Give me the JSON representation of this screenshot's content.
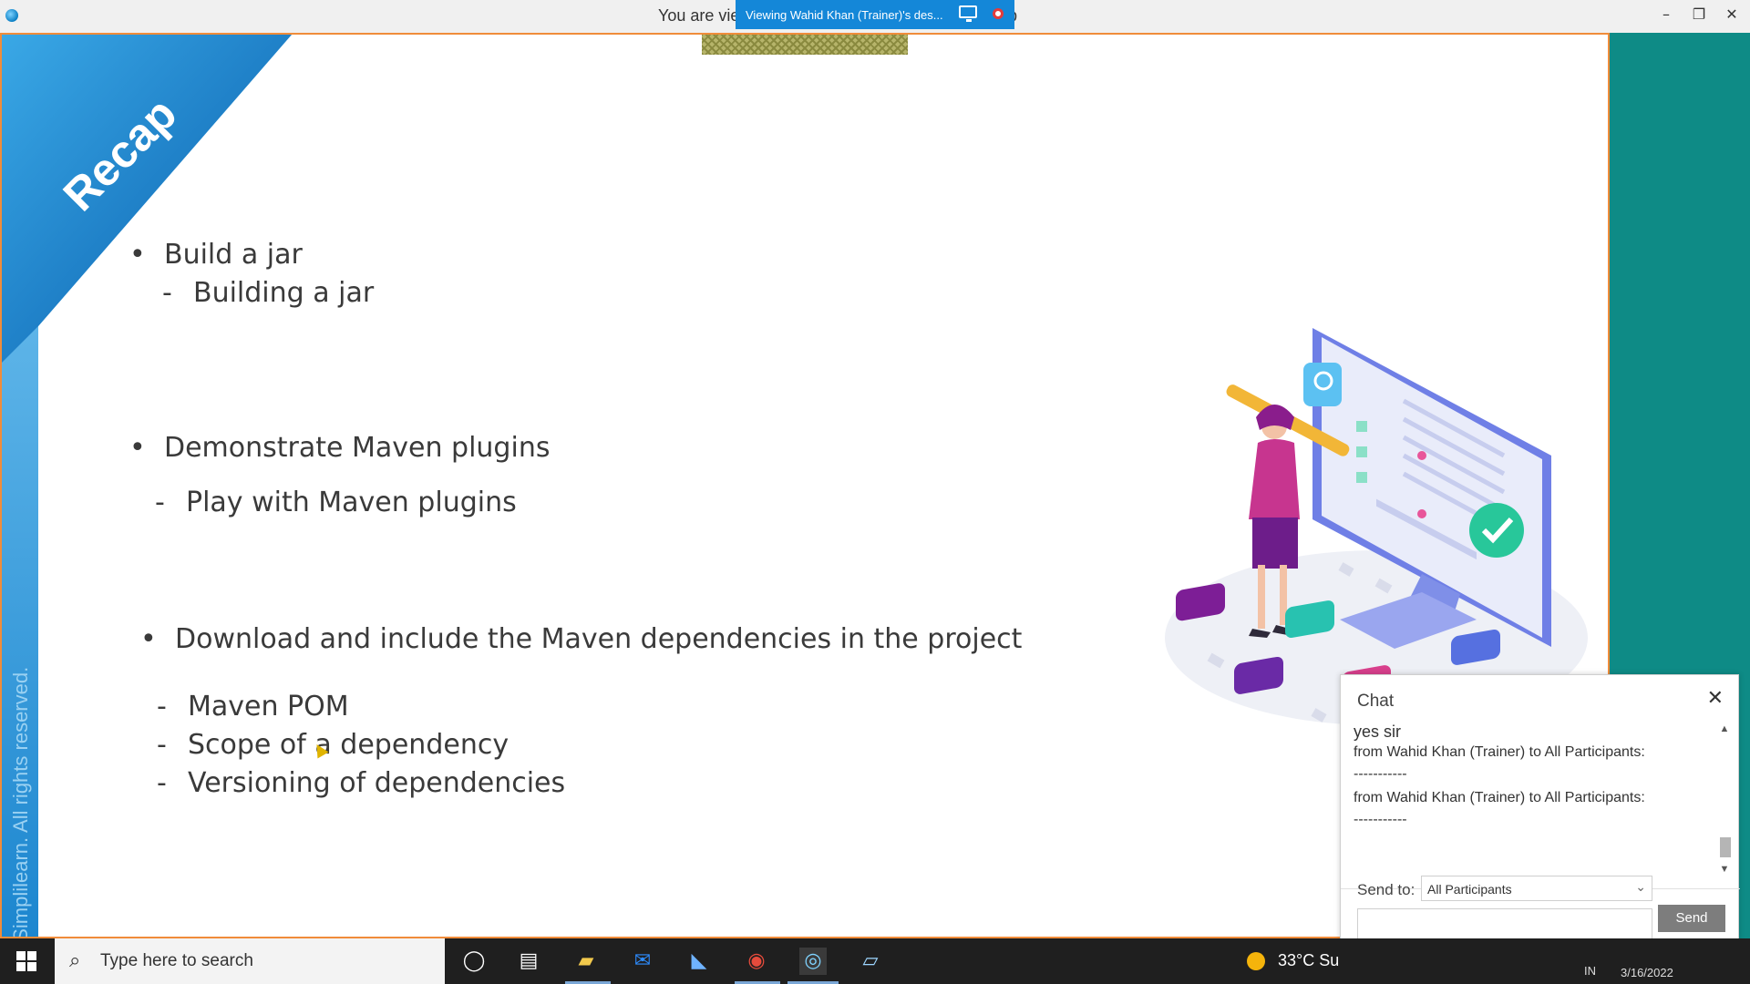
{
  "window": {
    "title_prefix": "You are vie",
    "title_suffix": "p",
    "sharing_banner": "Viewing Wahid Khan (Trainer)'s des...",
    "minimize": "–",
    "restore": "❐",
    "close": "✕"
  },
  "slide": {
    "badge": "Recap",
    "copyright": "©Simplilearn. All rights reserved.",
    "bullets": [
      {
        "text": "Build a jar",
        "subs": [
          "Building a jar"
        ]
      },
      {
        "text": "Demonstrate Maven plugins",
        "subs": [
          "Play with Maven plugins"
        ]
      },
      {
        "text": "Download and include the Maven dependencies in the project",
        "subs": [
          "Maven POM",
          "Scope of a dependency",
          "Versioning of dependencies"
        ]
      }
    ],
    "bullet_marker": "•",
    "sub_marker": "-"
  },
  "chat": {
    "title": "Chat",
    "messages": [
      {
        "text": "yes sir",
        "style": "big"
      },
      {
        "text": "from Wahid Khan (Trainer) to All Participants:"
      },
      {
        "text": "-----------"
      },
      {
        "text": "from Wahid Khan (Trainer) to All Participants:"
      },
      {
        "text": "-----------"
      }
    ],
    "send_to_label": "Send to:",
    "send_to_value": "All Participants",
    "send_button": "Send"
  },
  "taskbar": {
    "search_placeholder": "Type here to search",
    "weather": "33°C  Su",
    "tray_lang": "IN",
    "tray_date": "3/16/2022"
  },
  "colors": {
    "accent_blue": "#1487d8",
    "teal": "#0e8b86",
    "frame_orange": "#f08c3a"
  }
}
